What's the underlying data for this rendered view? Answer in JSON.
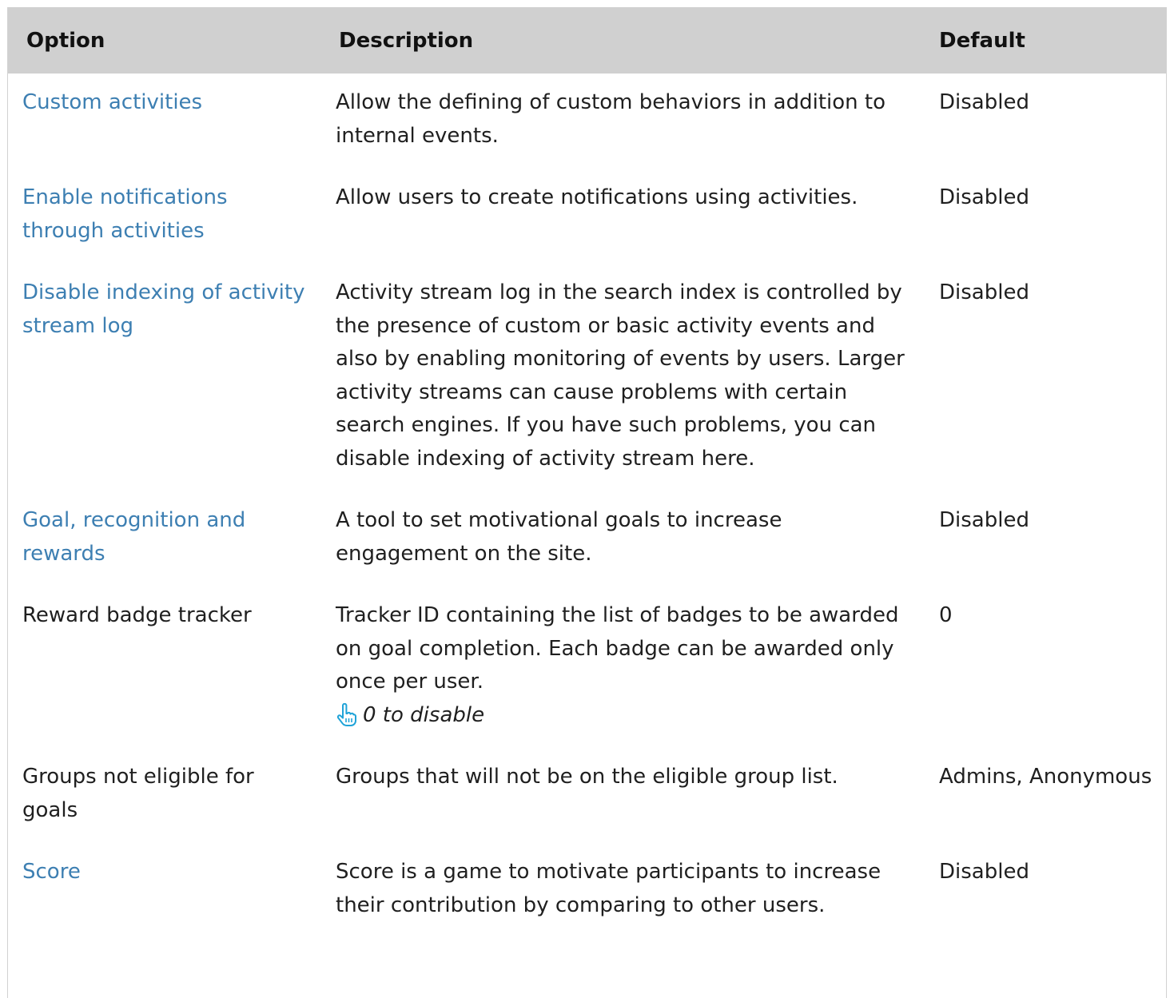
{
  "header": {
    "option": "Option",
    "description": "Description",
    "default": "Default"
  },
  "rows": [
    {
      "option": "Custom activities",
      "is_link": true,
      "description": "Allow the defining of custom behaviors in addition to internal events.",
      "default": "Disabled"
    },
    {
      "option": "Enable notifications through activities",
      "is_link": true,
      "description": "Allow users to create notifications using activities.",
      "default": "Disabled"
    },
    {
      "option": "Disable indexing of activity stream log",
      "is_link": true,
      "description": "Activity stream log in the search index is controlled by the presence of custom or basic activity events and also by enabling monitoring of events by users. Larger activity streams can cause problems with certain search engines. If you have such problems, you can disable indexing of activity stream here.",
      "default": "Disabled"
    },
    {
      "option": "Goal, recognition and rewards",
      "is_link": true,
      "description": "A tool to set motivational goals to increase engagement on the site.",
      "default": "Disabled"
    },
    {
      "option": "Reward badge tracker",
      "is_link": false,
      "description": "Tracker ID containing the list of badges to be awarded on goal completion. Each badge can be awarded only once per user.",
      "hint": "0 to disable",
      "hint_icon": "pointing-hand-icon",
      "default": "0"
    },
    {
      "option": "Groups not eligible for goals",
      "is_link": false,
      "description": "Groups that will not be on the eligible group list.",
      "default": "Admins, Anonymous"
    },
    {
      "option": "Score",
      "is_link": true,
      "description": "Score is a game to motivate participants to increase their contribution by comparing to other users.",
      "default": "Disabled"
    }
  ],
  "colors": {
    "link": "#3d7fb2",
    "header_bg": "#d0d0d0",
    "hint_icon": "#1fa3d8"
  }
}
